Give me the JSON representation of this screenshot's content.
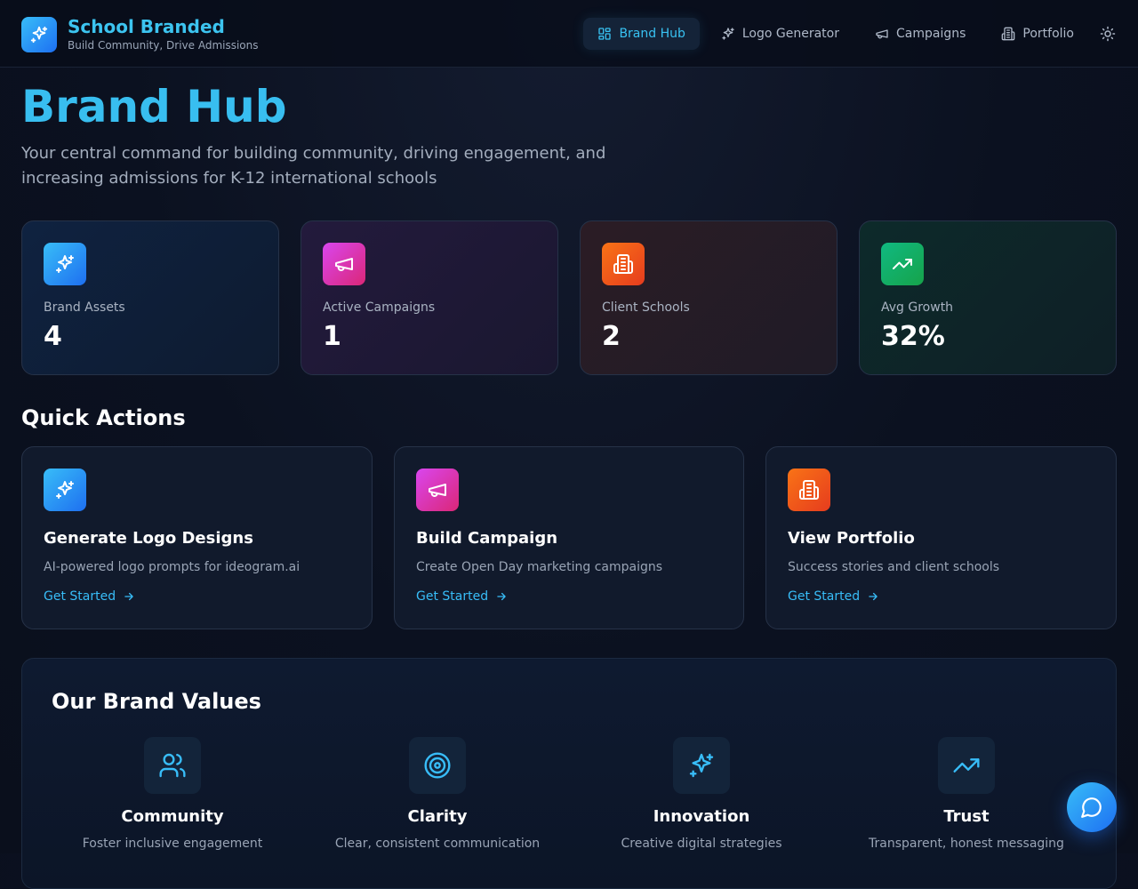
{
  "brand": {
    "title": "School Branded",
    "subtitle": "Build Community, Drive Admissions",
    "logo_icon": "sparkles-icon"
  },
  "nav": {
    "items": [
      {
        "label": "Brand Hub",
        "icon": "grid-icon",
        "active": true
      },
      {
        "label": "Logo Generator",
        "icon": "sparkles-icon"
      },
      {
        "label": "Campaigns",
        "icon": "megaphone-icon"
      },
      {
        "label": "Portfolio",
        "icon": "building-icon"
      }
    ],
    "theme_icon": "sun-icon"
  },
  "hero": {
    "title": "Brand Hub",
    "subtitle": "Your central command for building community, driving engagement, and increasing admissions for K-12 international schools"
  },
  "stats": [
    {
      "label": "Brand Assets",
      "value": "4",
      "icon": "sparkles-icon",
      "color": "#38bdf8"
    },
    {
      "label": "Active Campaigns",
      "value": "1",
      "icon": "megaphone-icon",
      "color": "#d946ef"
    },
    {
      "label": "Client Schools",
      "value": "2",
      "icon": "building-icon",
      "color": "#f97316"
    },
    {
      "label": "Avg Growth",
      "value": "32%",
      "icon": "trending-up-icon",
      "color": "#10b981"
    }
  ],
  "quick_actions": {
    "title": "Quick Actions",
    "items": [
      {
        "title": "Generate Logo Designs",
        "description": "AI-powered logo prompts for ideogram.ai",
        "link": "Get Started",
        "icon": "sparkles-icon"
      },
      {
        "title": "Build Campaign",
        "description": "Create Open Day marketing campaigns",
        "link": "Get Started",
        "icon": "megaphone-icon"
      },
      {
        "title": "View Portfolio",
        "description": "Success stories and client schools",
        "link": "Get Started",
        "icon": "building-icon"
      }
    ]
  },
  "values": {
    "title": "Our Brand Values",
    "items": [
      {
        "title": "Community",
        "description": "Foster inclusive engagement",
        "icon": "users-icon"
      },
      {
        "title": "Clarity",
        "description": "Clear, consistent communication",
        "icon": "target-icon"
      },
      {
        "title": "Innovation",
        "description": "Creative digital strategies",
        "icon": "sparkles-icon"
      },
      {
        "title": "Trust",
        "description": "Transparent, honest messaging",
        "icon": "trending-up-icon"
      }
    ]
  },
  "chat": {
    "icon": "chat-bubble-icon"
  },
  "colors": {
    "accent": "#38bdf8",
    "background": "#0b1120",
    "card_border": "#263248"
  }
}
